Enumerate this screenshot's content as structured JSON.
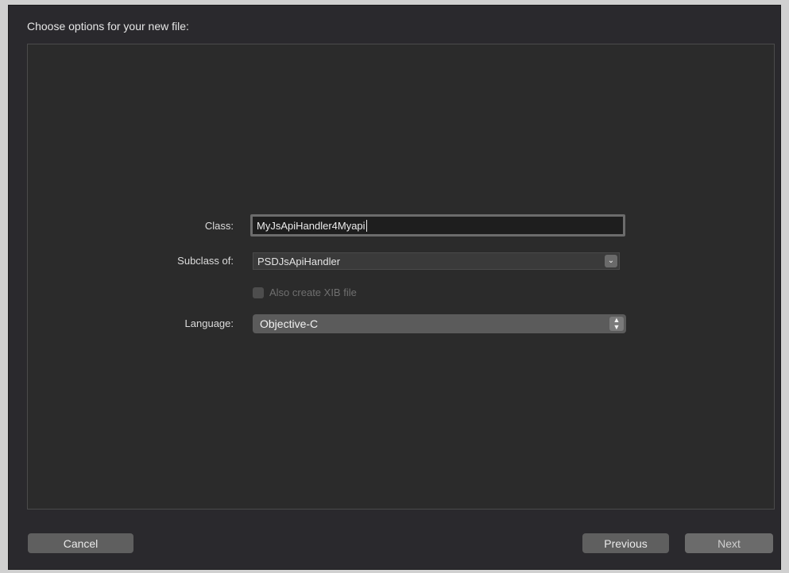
{
  "dialog": {
    "title": "Choose options for your new file:"
  },
  "form": {
    "class": {
      "label": "Class:",
      "value": "MyJsApiHandler4Myapi"
    },
    "subclass": {
      "label": "Subclass of:",
      "value": "PSDJsApiHandler"
    },
    "xib": {
      "label": "Also create XIB file",
      "checked": false,
      "enabled": false
    },
    "language": {
      "label": "Language:",
      "value": "Objective-C"
    }
  },
  "buttons": {
    "cancel": "Cancel",
    "previous": "Previous",
    "next": "Next"
  },
  "icons": {
    "subclass_dropdown": "chevron-down-icon",
    "language_popup": "up-down-arrows-icon"
  }
}
